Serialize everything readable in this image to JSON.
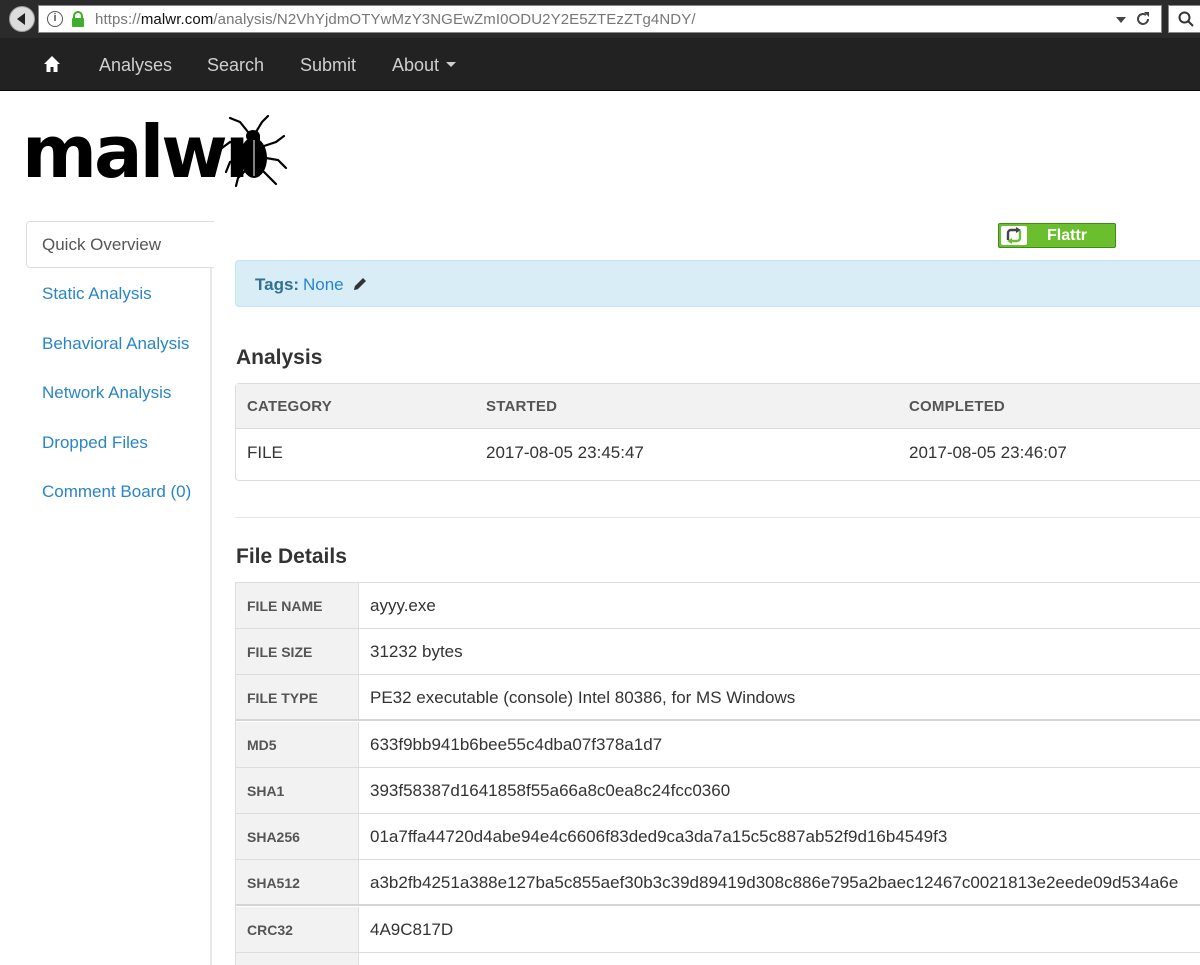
{
  "browser": {
    "url_prefix": "https://",
    "url_host": "malwr.com",
    "url_path": "/analysis/N2VhYjdmOTYwMzY3NGEwZmI0ODU2Y2E5ZTEzZTg4NDY/"
  },
  "navbar": {
    "items": [
      {
        "label": "Analyses"
      },
      {
        "label": "Search"
      },
      {
        "label": "Submit"
      },
      {
        "label": "About"
      }
    ]
  },
  "logo": {
    "text": "malwr"
  },
  "sidebar": {
    "items": [
      {
        "label": "Quick Overview"
      },
      {
        "label": "Static Analysis"
      },
      {
        "label": "Behavioral Analysis"
      },
      {
        "label": "Network Analysis"
      },
      {
        "label": "Dropped Files"
      },
      {
        "label": "Comment Board (0)"
      }
    ]
  },
  "flattr": {
    "label": "Flattr"
  },
  "tags": {
    "label": "Tags",
    "value": "None"
  },
  "analysis": {
    "title": "Analysis",
    "columns": [
      "CATEGORY",
      "STARTED",
      "COMPLETED"
    ],
    "row": [
      "FILE",
      "2017-08-05 23:45:47",
      "2017-08-05 23:46:07"
    ]
  },
  "file_details": {
    "title": "File Details",
    "rows": [
      {
        "key": "FILE NAME",
        "value": "ayyy.exe"
      },
      {
        "key": "FILE SIZE",
        "value": "31232 bytes"
      },
      {
        "key": "FILE TYPE",
        "value": "PE32 executable (console) Intel 80386, for MS Windows"
      },
      {
        "key": "MD5",
        "value": "633f9bb941b6bee55c4dba07f378a1d7"
      },
      {
        "key": "SHA1",
        "value": "393f58387d1641858f55a66a8c0ea8c24fcc0360"
      },
      {
        "key": "SHA256",
        "value": "01a7ffa44720d4abe94e4c6606f83ded9ca3da7a15c5c887ab52f9d16b4549f3"
      },
      {
        "key": "SHA512",
        "value": "a3b2fb4251a388e127ba5c855aef30b3c39d89419d308c886e795a2baec12467c0021813e2eede09d534a6e"
      },
      {
        "key": "CRC32",
        "value": "4A9C817D"
      }
    ]
  },
  "colors": {
    "navbar": "#222222",
    "link": "#2a85c8",
    "tags_bg": "#d9edf7",
    "flattr": "#6bbf2e"
  }
}
